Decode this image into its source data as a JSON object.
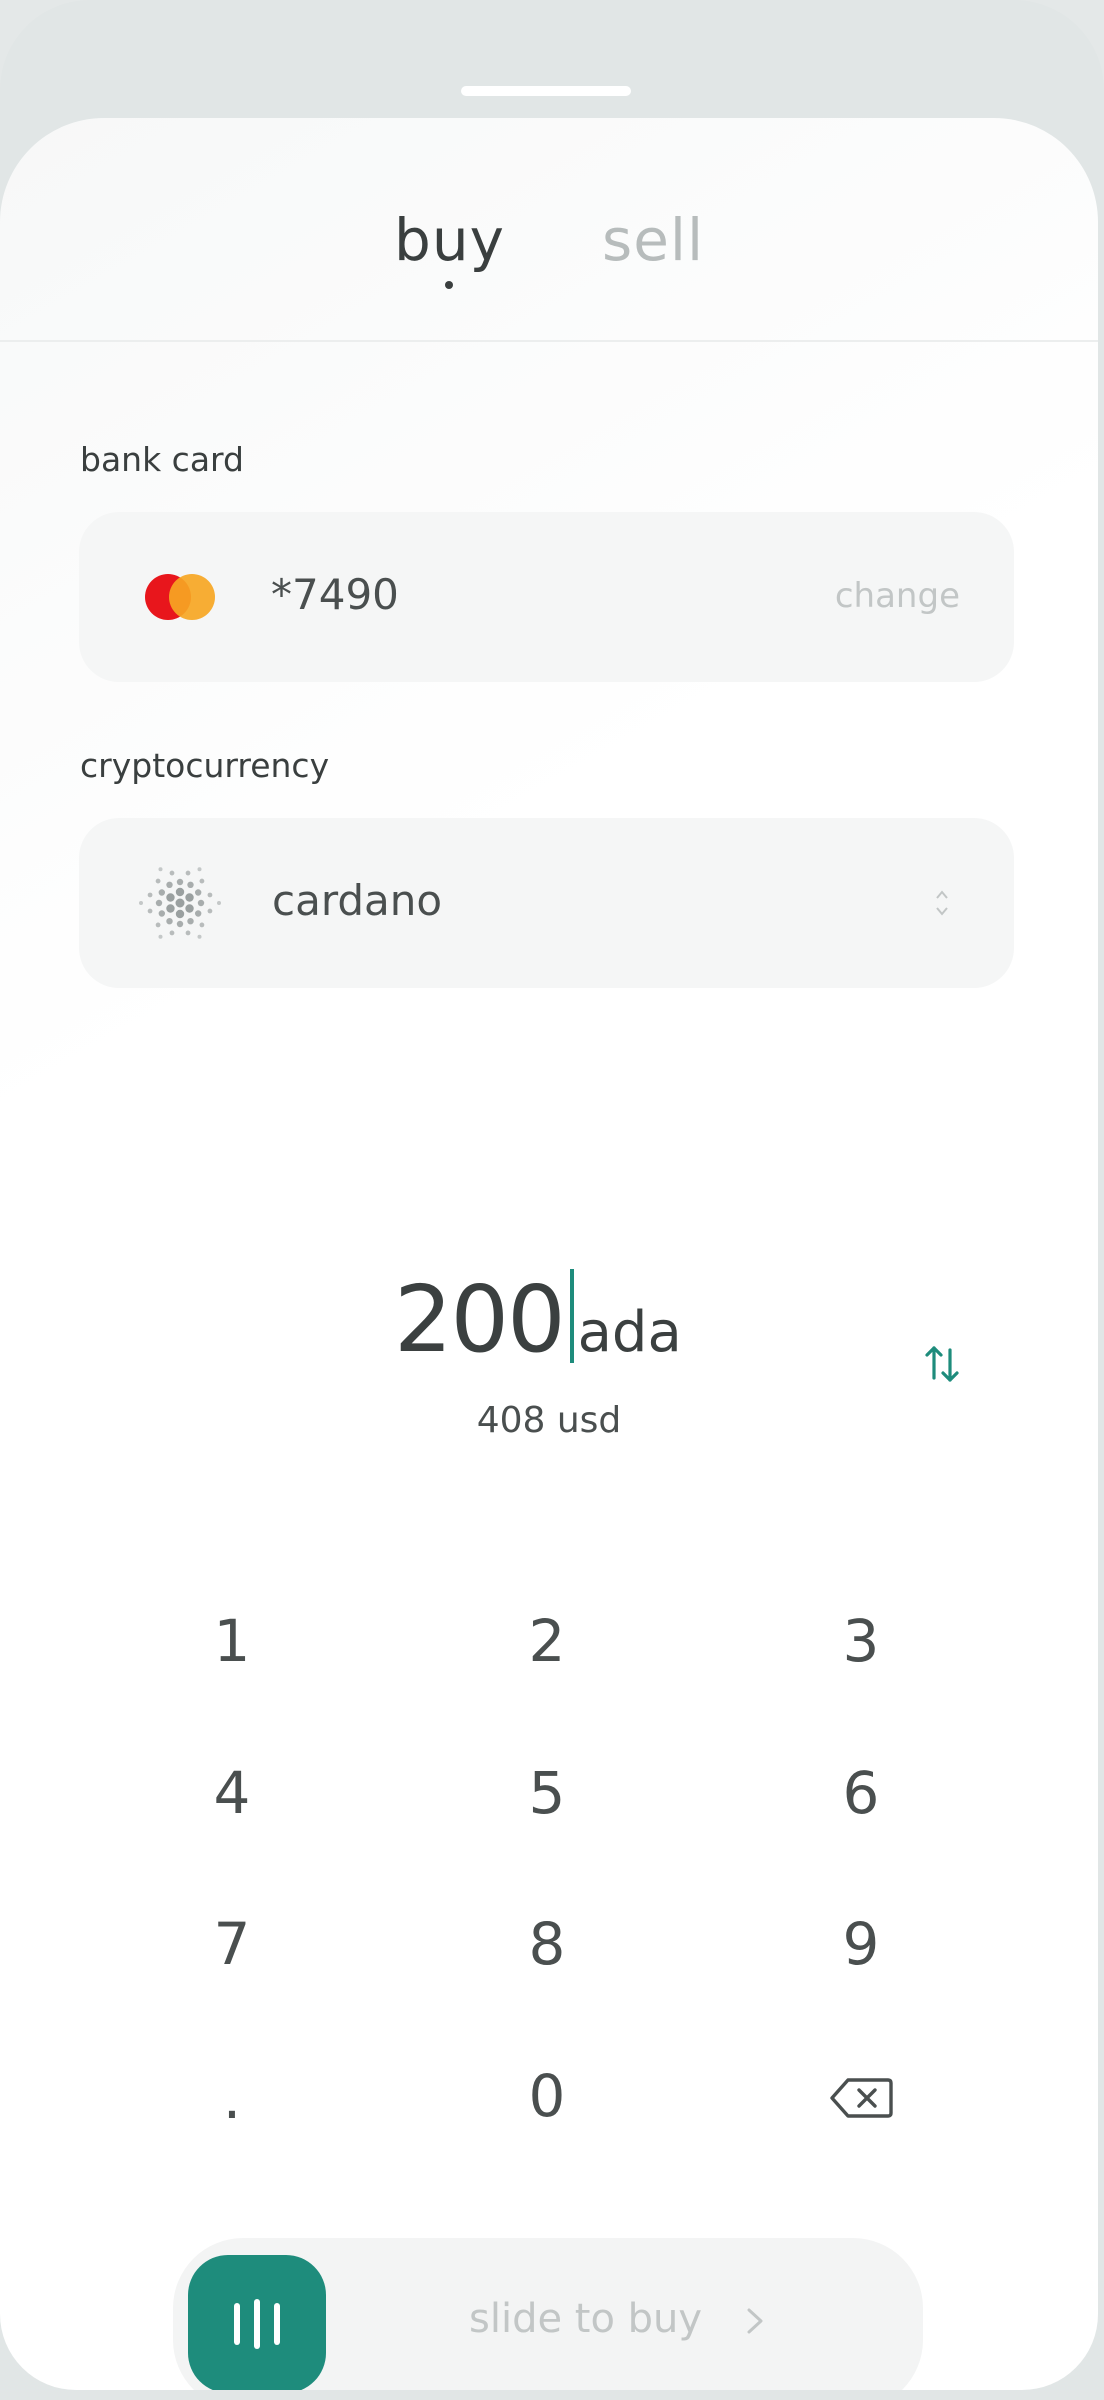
{
  "tabs": {
    "buy_label": "buy",
    "sell_label": "sell",
    "active": "buy"
  },
  "payment": {
    "label": "bank card",
    "card_icon": "mastercard-icon",
    "card_number": "*7490",
    "change_label": "change"
  },
  "crypto": {
    "label": "cryptocurrency",
    "icon": "cardano-icon",
    "name": "cardano",
    "selector_icon": "chevron-up-down-icon"
  },
  "amount": {
    "value": "200",
    "unit": "ada",
    "converted": "408 usd",
    "swap_icon": "swap-arrows-icon"
  },
  "keypad": {
    "keys": [
      "1",
      "2",
      "3",
      "4",
      "5",
      "6",
      "7",
      "8",
      "9",
      ".",
      "0"
    ],
    "backspace_icon": "backspace-icon"
  },
  "slider": {
    "label": "slide to buy",
    "thumb_icon": "grip-lines-icon",
    "chevron_icon": "chevron-right-icon"
  },
  "colors": {
    "accent": "#1e8c7c",
    "mastercard_red": "#e8161c",
    "mastercard_orange": "#f6a623"
  }
}
